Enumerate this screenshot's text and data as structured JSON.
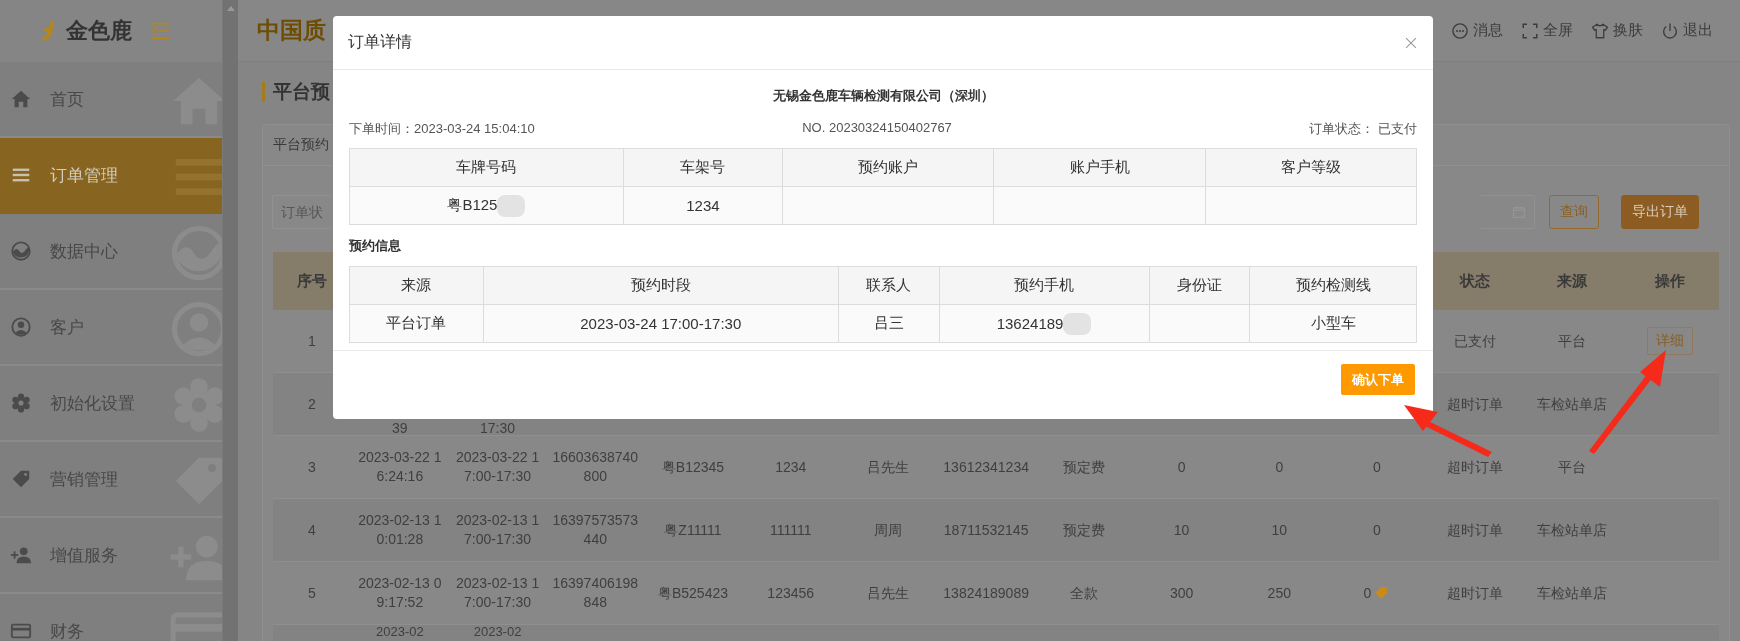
{
  "sidebar": {
    "logo": "金色鹿",
    "items": [
      {
        "label": "首页",
        "selected": false
      },
      {
        "label": "订单管理",
        "selected": true
      },
      {
        "label": "数据中心",
        "selected": false
      },
      {
        "label": "客户",
        "selected": false
      },
      {
        "label": "初始化设置",
        "selected": false
      },
      {
        "label": "营销管理",
        "selected": false
      },
      {
        "label": "增值服务",
        "selected": false
      },
      {
        "label": "财务",
        "selected": false
      }
    ]
  },
  "topbar": {
    "title": "中国质",
    "actions": [
      "消息",
      "全屏",
      "换肤",
      "退出"
    ]
  },
  "page": {
    "title": "平台预",
    "tab": "平台预约",
    "filter_placeholder": "订单状",
    "buttons": [
      {
        "label": "查询",
        "kind": "outline"
      },
      {
        "label": "导出订单",
        "kind": "filled"
      }
    ]
  },
  "table": {
    "header": {
      "no": "序号",
      "status": "状态",
      "source": "来源",
      "action": "操作"
    },
    "rows": [
      {
        "no": "1",
        "status": "已支付",
        "source": "平台",
        "action": "详细",
        "coupon": false
      },
      {
        "no": "2",
        "column_2": "39",
        "column_3": "17:30",
        "status": "超时订单",
        "source": "车检站单店",
        "coupon": false
      },
      {
        "no": "3",
        "column_2": "2023-03-22 16:24:16",
        "column_3": "2023-03-22 17:00-17:30",
        "column_4": "16603638740800",
        "column_5": "粤B12345",
        "column_6": "1234",
        "column_7": "吕先生",
        "column_8": "13612341234",
        "column_9": "预定费",
        "column_10": "0",
        "column_11": "0",
        "column_12": "0",
        "status": "超时订单",
        "source": "平台",
        "coupon": false
      },
      {
        "no": "4",
        "column_2": "2023-02-13 10:01:28",
        "column_3": "2023-02-13 17:00-17:30",
        "column_4": "16397573573440",
        "column_5": "粤Z11111",
        "column_6": "111111",
        "column_7": "周周",
        "column_8": "18711532145",
        "column_9": "预定费",
        "column_10": "10",
        "column_11": "10",
        "column_12": "0",
        "status": "超时订单",
        "source": "车检站单店",
        "coupon": false
      },
      {
        "no": "5",
        "column_2": "2023-02-13 09:17:52",
        "column_3": "2023-02-13 17:00-17:30",
        "column_4": "16397406198848",
        "column_5": "粤B525423",
        "column_6": "123456",
        "column_7": "吕先生",
        "column_8": "13824189089",
        "column_9": "全款",
        "column_10": "300",
        "column_11": "250",
        "column_12": "0",
        "status": "超时订单",
        "source": "车检站单店",
        "coupon": true
      },
      {
        "column_2": "2023-02",
        "column_3": "2023-02",
        "coupon": false
      }
    ]
  },
  "dialog": {
    "title": "订单详情",
    "company": "无锡金色鹿车辆检测有限公司（深圳）",
    "order_time": "下单时间：2023-03-24 15:04:10",
    "order_no": "NO. 20230324150402767",
    "order_status": "订单状态： 已支付",
    "vehicle_table": {
      "columns": [
        "车牌号码",
        "车架号",
        "预约账户",
        "账户手机",
        "客户等级"
      ],
      "rows": [
        [
          {
            "text": "粤B125",
            "blurred": true
          },
          "1234",
          null,
          null,
          null
        ]
      ]
    },
    "section_title": "预约信息",
    "booking_table": {
      "columns": [
        "来源",
        "预约时段",
        "联系人",
        "预约手机",
        "身份证",
        "预约检测线"
      ],
      "rows": [
        [
          "平台订单",
          "2023-03-24 17:00-17:30",
          "吕三",
          {
            "text": "13624189",
            "blurred": true
          },
          null,
          "小型车"
        ]
      ]
    },
    "confirm_button": "确认下单"
  }
}
